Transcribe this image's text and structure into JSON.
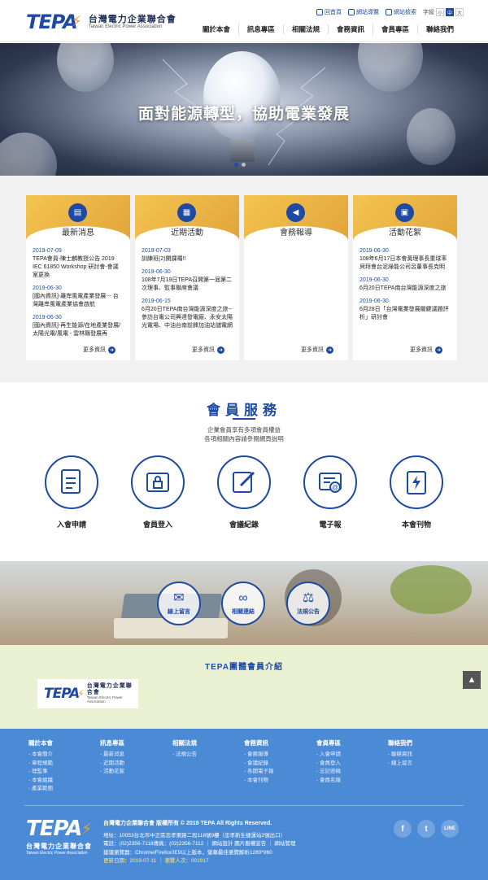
{
  "header": {
    "logo_mark": "TEPA",
    "logo_zh": "台灣電力企業聯合會",
    "logo_en": "Taiwan Electric Power Association",
    "util": [
      {
        "label": "回首頁",
        "icon": "home-icon"
      },
      {
        "label": "網站導覽",
        "icon": "sitemap-icon"
      },
      {
        "label": "網站檢索",
        "icon": "search-icon"
      }
    ],
    "font_size_label": "字級",
    "font_sizes": [
      "小",
      "中",
      "大"
    ],
    "nav": [
      "關於本會",
      "訊息專區",
      "相關法規",
      "會務資訊",
      "會員專區",
      "聯絡我們"
    ]
  },
  "hero": {
    "title": "面對能源轉型，協助電業發展"
  },
  "news": {
    "more_label": "更多資訊",
    "cards": [
      {
        "title": "最新消息",
        "icon": "news-icon",
        "items": [
          {
            "date": "2019-07-09",
            "text": "TEPA會員-陳士麟教授公告 2019 IEC 61850 Workshop 研討會-會議室更換"
          },
          {
            "date": "2019-06-30",
            "text": "[國內資訊]-離岸風電產業發展 -- 台灣離岸風電產業協會啟航"
          },
          {
            "date": "2019-06-30",
            "text": "[國內資訊]-再生能源/在地產業發展/太陽光電/風電 - 雲林縣發展再"
          }
        ]
      },
      {
        "title": "近期活動",
        "icon": "calendar-icon",
        "items": [
          {
            "date": "2019-07-03",
            "text": "訓練班(2)開課囉!!"
          },
          {
            "date": "2019-06-30",
            "text": "108年7月19日TEPA召開第一屆第二次理事、監事聯席會議"
          },
          {
            "date": "2019-06-15",
            "text": "6月20日TEPA南台灣能源深度之旅-- 參訪台電公司興達發電廠、永安太陽光電場、中油台南前鋒加油站儲電網"
          }
        ]
      },
      {
        "title": "會務報導",
        "icon": "megaphone-icon",
        "items": []
      },
      {
        "title": "活動花絮",
        "icon": "photo-icon",
        "items": [
          {
            "date": "2019-06-30",
            "text": "108年6月17日本會黃理事長重球率貝拜會台泥綠能公司呂董事長克明"
          },
          {
            "date": "2019-06-30",
            "text": "6月20日TEPA南台灣能源深度之旅"
          },
          {
            "date": "2019-06-30",
            "text": "6月28日「台灣電業發展關鍵議題評析」研討會"
          }
        ]
      }
    ]
  },
  "services": {
    "title": "會員服務",
    "subtitle_1": "企業會員享有多項會員權益",
    "subtitle_2": "各項相關內容請參閱網頁說明",
    "items": [
      {
        "label": "入會申請",
        "icon": "application-form-icon"
      },
      {
        "label": "會員登入",
        "icon": "lock-login-icon"
      },
      {
        "label": "會議紀錄",
        "icon": "edit-notes-icon"
      },
      {
        "label": "電子報",
        "icon": "newsletter-icon"
      },
      {
        "label": "本會刊物",
        "icon": "publication-icon"
      }
    ]
  },
  "links": {
    "items": [
      {
        "label": "線上留言",
        "icon": "mail-icon"
      },
      {
        "label": "相關連結",
        "icon": "link-icon"
      },
      {
        "label": "法規公告",
        "icon": "scales-icon"
      }
    ]
  },
  "members": {
    "title": "TEPA團體會員介紹",
    "logo_mark": "TEPA",
    "logo_zh": "台灣電力企業聯合會",
    "logo_en": "Taiwan Electric Power Association"
  },
  "footer": {
    "columns": [
      {
        "title": "關於本會",
        "items": [
          "- 本會簡介",
          "- 章程規範",
          "- 理監事",
          "- 本會組織",
          "- 產業範圍"
        ]
      },
      {
        "title": "訊息專區",
        "items": [
          "- 最新消息",
          "- 近期活動",
          "- 活動花絮"
        ]
      },
      {
        "title": "相關法規",
        "items": [
          "- 法規公告"
        ]
      },
      {
        "title": "會務資訊",
        "items": [
          "- 會務報導",
          "- 會議紀錄",
          "- 各期電子報",
          "- 本會刊物"
        ]
      },
      {
        "title": "會員專區",
        "items": [
          "- 入會申請",
          "- 會員登入",
          "- 忘記密碼",
          "- 會員名錄"
        ]
      },
      {
        "title": "聯絡我們",
        "items": [
          "- 聯絡資訊",
          "- 線上留言"
        ]
      }
    ],
    "logo_mark": "TEPA",
    "logo_zh": "台灣電力企業聯合會",
    "logo_en": "Taiwan Electric Power Association",
    "copyright": "台灣電力企業聯合會 版權所有 © 2019 TEPA All Rights Reserved.",
    "address": "地址：10053台北市中正區忠孝東路二段118號9樓（忠孝新生捷運站2號出口）",
    "phone": "電話：(02)2356-7118傳真：(02)2356-7112 ｜ 網站設計 圓片服權宣告 ｜ 網站管理",
    "browser": "建議瀏覽器：Chrome/Firefox/IE9以上版本，螢幕最佳瀏覽解析1280*960",
    "update": "更新日期：2019-07-11 ｜ 瀏覽人次：001917",
    "social": [
      {
        "label": "f",
        "icon": "facebook-icon"
      },
      {
        "label": "t",
        "icon": "twitter-icon"
      },
      {
        "label": "LINE",
        "icon": "line-icon"
      }
    ]
  },
  "colors": {
    "brand_blue": "#1e4aa3",
    "accent_yellow": "#f3a21b",
    "footer_blue": "#4b8bd6",
    "member_bg": "#eaf0d2"
  }
}
